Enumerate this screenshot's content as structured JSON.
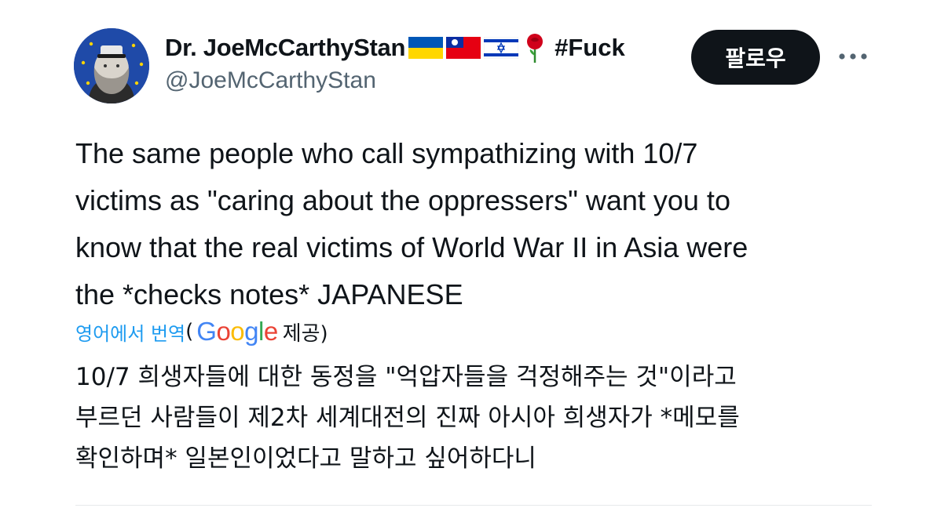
{
  "author": {
    "display_name": "Dr. JoeMcCarthyStan",
    "hashtag": "#Fuck",
    "handle": "@JoeMcCarthyStan",
    "badges": [
      "ukraine-flag",
      "taiwan-flag",
      "israel-flag",
      "rose-icon"
    ]
  },
  "actions": {
    "follow_label": "팔로우",
    "more_icon": "more-horizontal-icon"
  },
  "tweet": {
    "lines": [
      "The same people who call sympathizing with 10/7",
      "victims as \"caring about the oppressers\" want you to",
      "know that the real victims of World War II in Asia were",
      "the *checks notes* JAPANESE"
    ]
  },
  "translation": {
    "link_label": "영어에서 번역",
    "open_paren": "(",
    "provider": {
      "g1": "G",
      "o1": "o",
      "o2": "o",
      "g2": "g",
      "l": "l",
      "e": "e"
    },
    "provided_label": "제공)",
    "lines": [
      "10/7 희생자들에 대한 동정을 \"억압자들을 걱정해주는 것\"이라고",
      "부르던 사람들이 제2차 세계대전의 진짜 아시아 희생자가 *메모를",
      "확인하며* 일본인이었다고 말하고 싶어하다니"
    ]
  },
  "colors": {
    "text": "#0f1419",
    "secondary": "#536471",
    "link": "#1d9bf0",
    "button_bg": "#0f1419",
    "button_text": "#ffffff"
  }
}
